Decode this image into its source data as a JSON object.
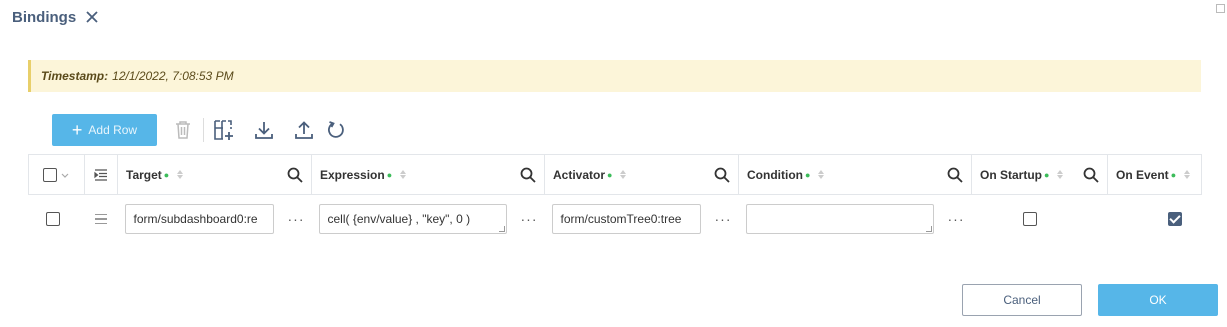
{
  "dialog": {
    "title": "Bindings"
  },
  "banner": {
    "label": "Timestamp:",
    "value": "12/1/2022, 7:08:53 PM"
  },
  "toolbar": {
    "add_row_label": "Add Row"
  },
  "columns": {
    "target": "Target",
    "expression": "Expression",
    "activator": "Activator",
    "condition": "Condition",
    "on_startup": "On Startup",
    "on_event": "On Event"
  },
  "rows": [
    {
      "target": "form/subdashboard0:re",
      "expression": "cell( {env/value} , \"key\", 0 )",
      "activator": "form/customTree0:tree",
      "condition": "",
      "on_startup": false,
      "on_event": true
    }
  ],
  "more_label": "···",
  "footer": {
    "cancel_label": "Cancel",
    "ok_label": "OK"
  },
  "colors": {
    "accent": "#56b6e8",
    "title": "#4a5f7c",
    "banner_bg": "#fcf5d9",
    "required_dot": "#3cbc5a"
  }
}
